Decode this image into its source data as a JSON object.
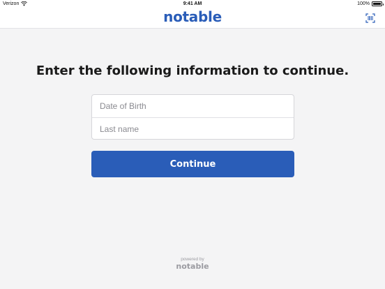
{
  "status_bar": {
    "carrier": "Verizon",
    "time": "9:41 AM",
    "battery": "100%"
  },
  "header": {
    "logo_text": "notable",
    "scan_icon": "barcode-scan-icon"
  },
  "main": {
    "heading": "Enter the following information to continue.",
    "fields": {
      "dob": {
        "placeholder": "Date of Birth",
        "value": ""
      },
      "last_name": {
        "placeholder": "Last name",
        "value": ""
      }
    },
    "continue_label": "Continue"
  },
  "footer": {
    "powered_by": "powered by",
    "logo_text": "notable"
  },
  "colors": {
    "brand": "#2a5db8",
    "background": "#f4f4f5"
  }
}
